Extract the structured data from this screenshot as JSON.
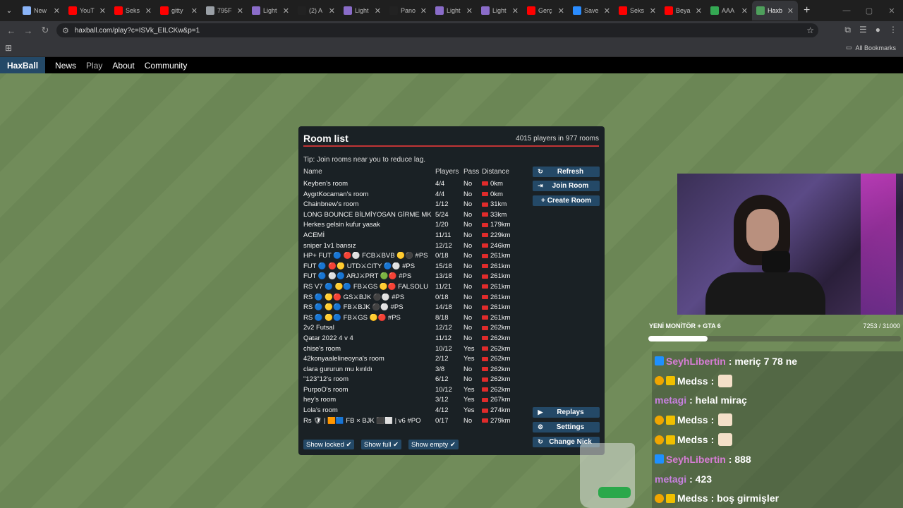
{
  "browser": {
    "tabs": [
      {
        "title": "New",
        "color": "#8ab4f8"
      },
      {
        "title": "YouT",
        "color": "#ff0000"
      },
      {
        "title": "Seks",
        "color": "#ff0000"
      },
      {
        "title": "gitty",
        "color": "#ff0000"
      },
      {
        "title": "795F",
        "color": "#9aa0a6"
      },
      {
        "title": "Light",
        "color": "#8a6cc9"
      },
      {
        "title": "(2) A",
        "color": "#222222"
      },
      {
        "title": "Light",
        "color": "#8a6cc9"
      },
      {
        "title": "Pano",
        "color": "#222222"
      },
      {
        "title": "Light",
        "color": "#8a6cc9"
      },
      {
        "title": "Light",
        "color": "#8a6cc9"
      },
      {
        "title": "Gerç",
        "color": "#ff0000"
      },
      {
        "title": "Save",
        "color": "#2a8cff"
      },
      {
        "title": "Seks",
        "color": "#ff0000"
      },
      {
        "title": "Beya",
        "color": "#ff0000"
      },
      {
        "title": "AAA",
        "color": "#34a853"
      },
      {
        "title": "Haxb",
        "color": "#4e9f5c"
      }
    ],
    "url": "haxball.com/play?c=ISVk_EILCKw&p=1",
    "all_bookmarks": "All Bookmarks"
  },
  "nav": {
    "logo": "HaxBall",
    "links": [
      "News",
      "Play",
      "About",
      "Community"
    ]
  },
  "room_list": {
    "title": "Room list",
    "count": "4015 players in 977 rooms",
    "tip": "Tip: Join rooms near you to reduce lag.",
    "headers": {
      "name": "Name",
      "players": "Players",
      "pass": "Pass",
      "distance": "Distance"
    },
    "rooms": [
      {
        "name": "Keyben's room",
        "players": "4/4",
        "pass": "No",
        "distance": "0km"
      },
      {
        "name": "AygıtKocaman's room",
        "players": "4/4",
        "pass": "No",
        "distance": "0km"
      },
      {
        "name": "Chainbnew's room",
        "players": "1/12",
        "pass": "No",
        "distance": "31km"
      },
      {
        "name": "LONG BOUNCE BİLMİYOSAN GİRME MK",
        "players": "5/24",
        "pass": "No",
        "distance": "33km"
      },
      {
        "name": "Herkes gelsin kufur yasak",
        "players": "1/20",
        "pass": "No",
        "distance": "179km"
      },
      {
        "name": "ACEMİ",
        "players": "11/11",
        "pass": "No",
        "distance": "229km"
      },
      {
        "name": "sniper 1v1 bansız",
        "players": "12/12",
        "pass": "No",
        "distance": "246km"
      },
      {
        "name": "HP+ FUT 🔵 🔴⚪ FCB⚔BVB 🟡⚫ #PS",
        "players": "0/18",
        "pass": "No",
        "distance": "261km"
      },
      {
        "name": "FUT 🔵 🔴🟡 UTD⚔CITY 🔵⚪ #PS",
        "players": "15/18",
        "pass": "No",
        "distance": "261km"
      },
      {
        "name": "FUT 🔵 ⚪🔵 ARJ⚔PRT 🟢🔴 #PS",
        "players": "13/18",
        "pass": "No",
        "distance": "261km"
      },
      {
        "name": "RS V7 🔵 🟡🔵 FB⚔GS 🟡🔴 FALSOLU",
        "players": "11/21",
        "pass": "No",
        "distance": "261km"
      },
      {
        "name": "RS 🔵 🟡🔴 GS⚔BJK ⚫⚪ #PS",
        "players": "0/18",
        "pass": "No",
        "distance": "261km"
      },
      {
        "name": "RS 🔵 🟡🔵 FB⚔BJK ⚫⚪ #PS",
        "players": "14/18",
        "pass": "No",
        "distance": "261km"
      },
      {
        "name": "RS 🔵 🟡🔵 FB⚔GS 🟡🔴 #PS",
        "players": "8/18",
        "pass": "No",
        "distance": "261km"
      },
      {
        "name": "2v2 Futsal",
        "players": "12/12",
        "pass": "No",
        "distance": "262km"
      },
      {
        "name": "Qatar 2022 4 v 4",
        "players": "11/12",
        "pass": "No",
        "distance": "262km"
      },
      {
        "name": "chise's room",
        "players": "10/12",
        "pass": "Yes",
        "distance": "262km"
      },
      {
        "name": "42konyaalelineoyna's room",
        "players": "2/12",
        "pass": "Yes",
        "distance": "262km"
      },
      {
        "name": "clara gururun mu kırıldı",
        "players": "3/8",
        "pass": "No",
        "distance": "262km"
      },
      {
        "name": "\"123\"12's room",
        "players": "6/12",
        "pass": "No",
        "distance": "262km"
      },
      {
        "name": "PurpoO's room",
        "players": "10/12",
        "pass": "Yes",
        "distance": "262km"
      },
      {
        "name": "hey's room",
        "players": "3/12",
        "pass": "Yes",
        "distance": "267km"
      },
      {
        "name": "Lola's room",
        "players": "4/12",
        "pass": "Yes",
        "distance": "274km"
      },
      {
        "name": "Rs 🛡 | 🟧🟦 FB × BJK ⬛⬜ | v6 #PO",
        "players": "0/17",
        "pass": "No",
        "distance": "279km"
      }
    ],
    "buttons": {
      "refresh": "Refresh",
      "join": "Join Room",
      "create": "Create Room",
      "replays": "Replays",
      "settings": "Settings",
      "change_nick": "Change Nick"
    },
    "filters": {
      "locked": "Show locked ✔",
      "full": "Show full ✔",
      "empty": "Show empty ✔"
    }
  },
  "stream": {
    "goal_label": "YENİ MONİTÖR + GTA 6",
    "goal_value": "7253 / 31000",
    "goal_fraction": 0.234,
    "chat": [
      {
        "user": "SeyhLibertin",
        "text": ": meriç 7 78 ne",
        "color": "#d77dd6",
        "badges": [
          "blue"
        ]
      },
      {
        "user": "Medss",
        "text": ":",
        "color": "#ffffff",
        "badges": [
          "gold",
          "crown"
        ],
        "emote": true
      },
      {
        "user": "metagi",
        "text": ": helal miraç",
        "color": "#c880e0",
        "badges": []
      },
      {
        "user": "Medss",
        "text": ":",
        "color": "#ffffff",
        "badges": [
          "gold",
          "crown"
        ],
        "emote": true
      },
      {
        "user": "Medss",
        "text": ":",
        "color": "#ffffff",
        "badges": [
          "gold",
          "crown"
        ],
        "emote": true
      },
      {
        "user": "SeyhLibertin",
        "text": ": 888",
        "color": "#d77dd6",
        "badges": [
          "blue"
        ]
      },
      {
        "user": "metagi",
        "text": ": 423",
        "color": "#c880e0",
        "badges": []
      },
      {
        "user": "Medss",
        "text": ": boş girmişler",
        "color": "#ffffff",
        "badges": [
          "gold",
          "crown"
        ]
      }
    ]
  }
}
